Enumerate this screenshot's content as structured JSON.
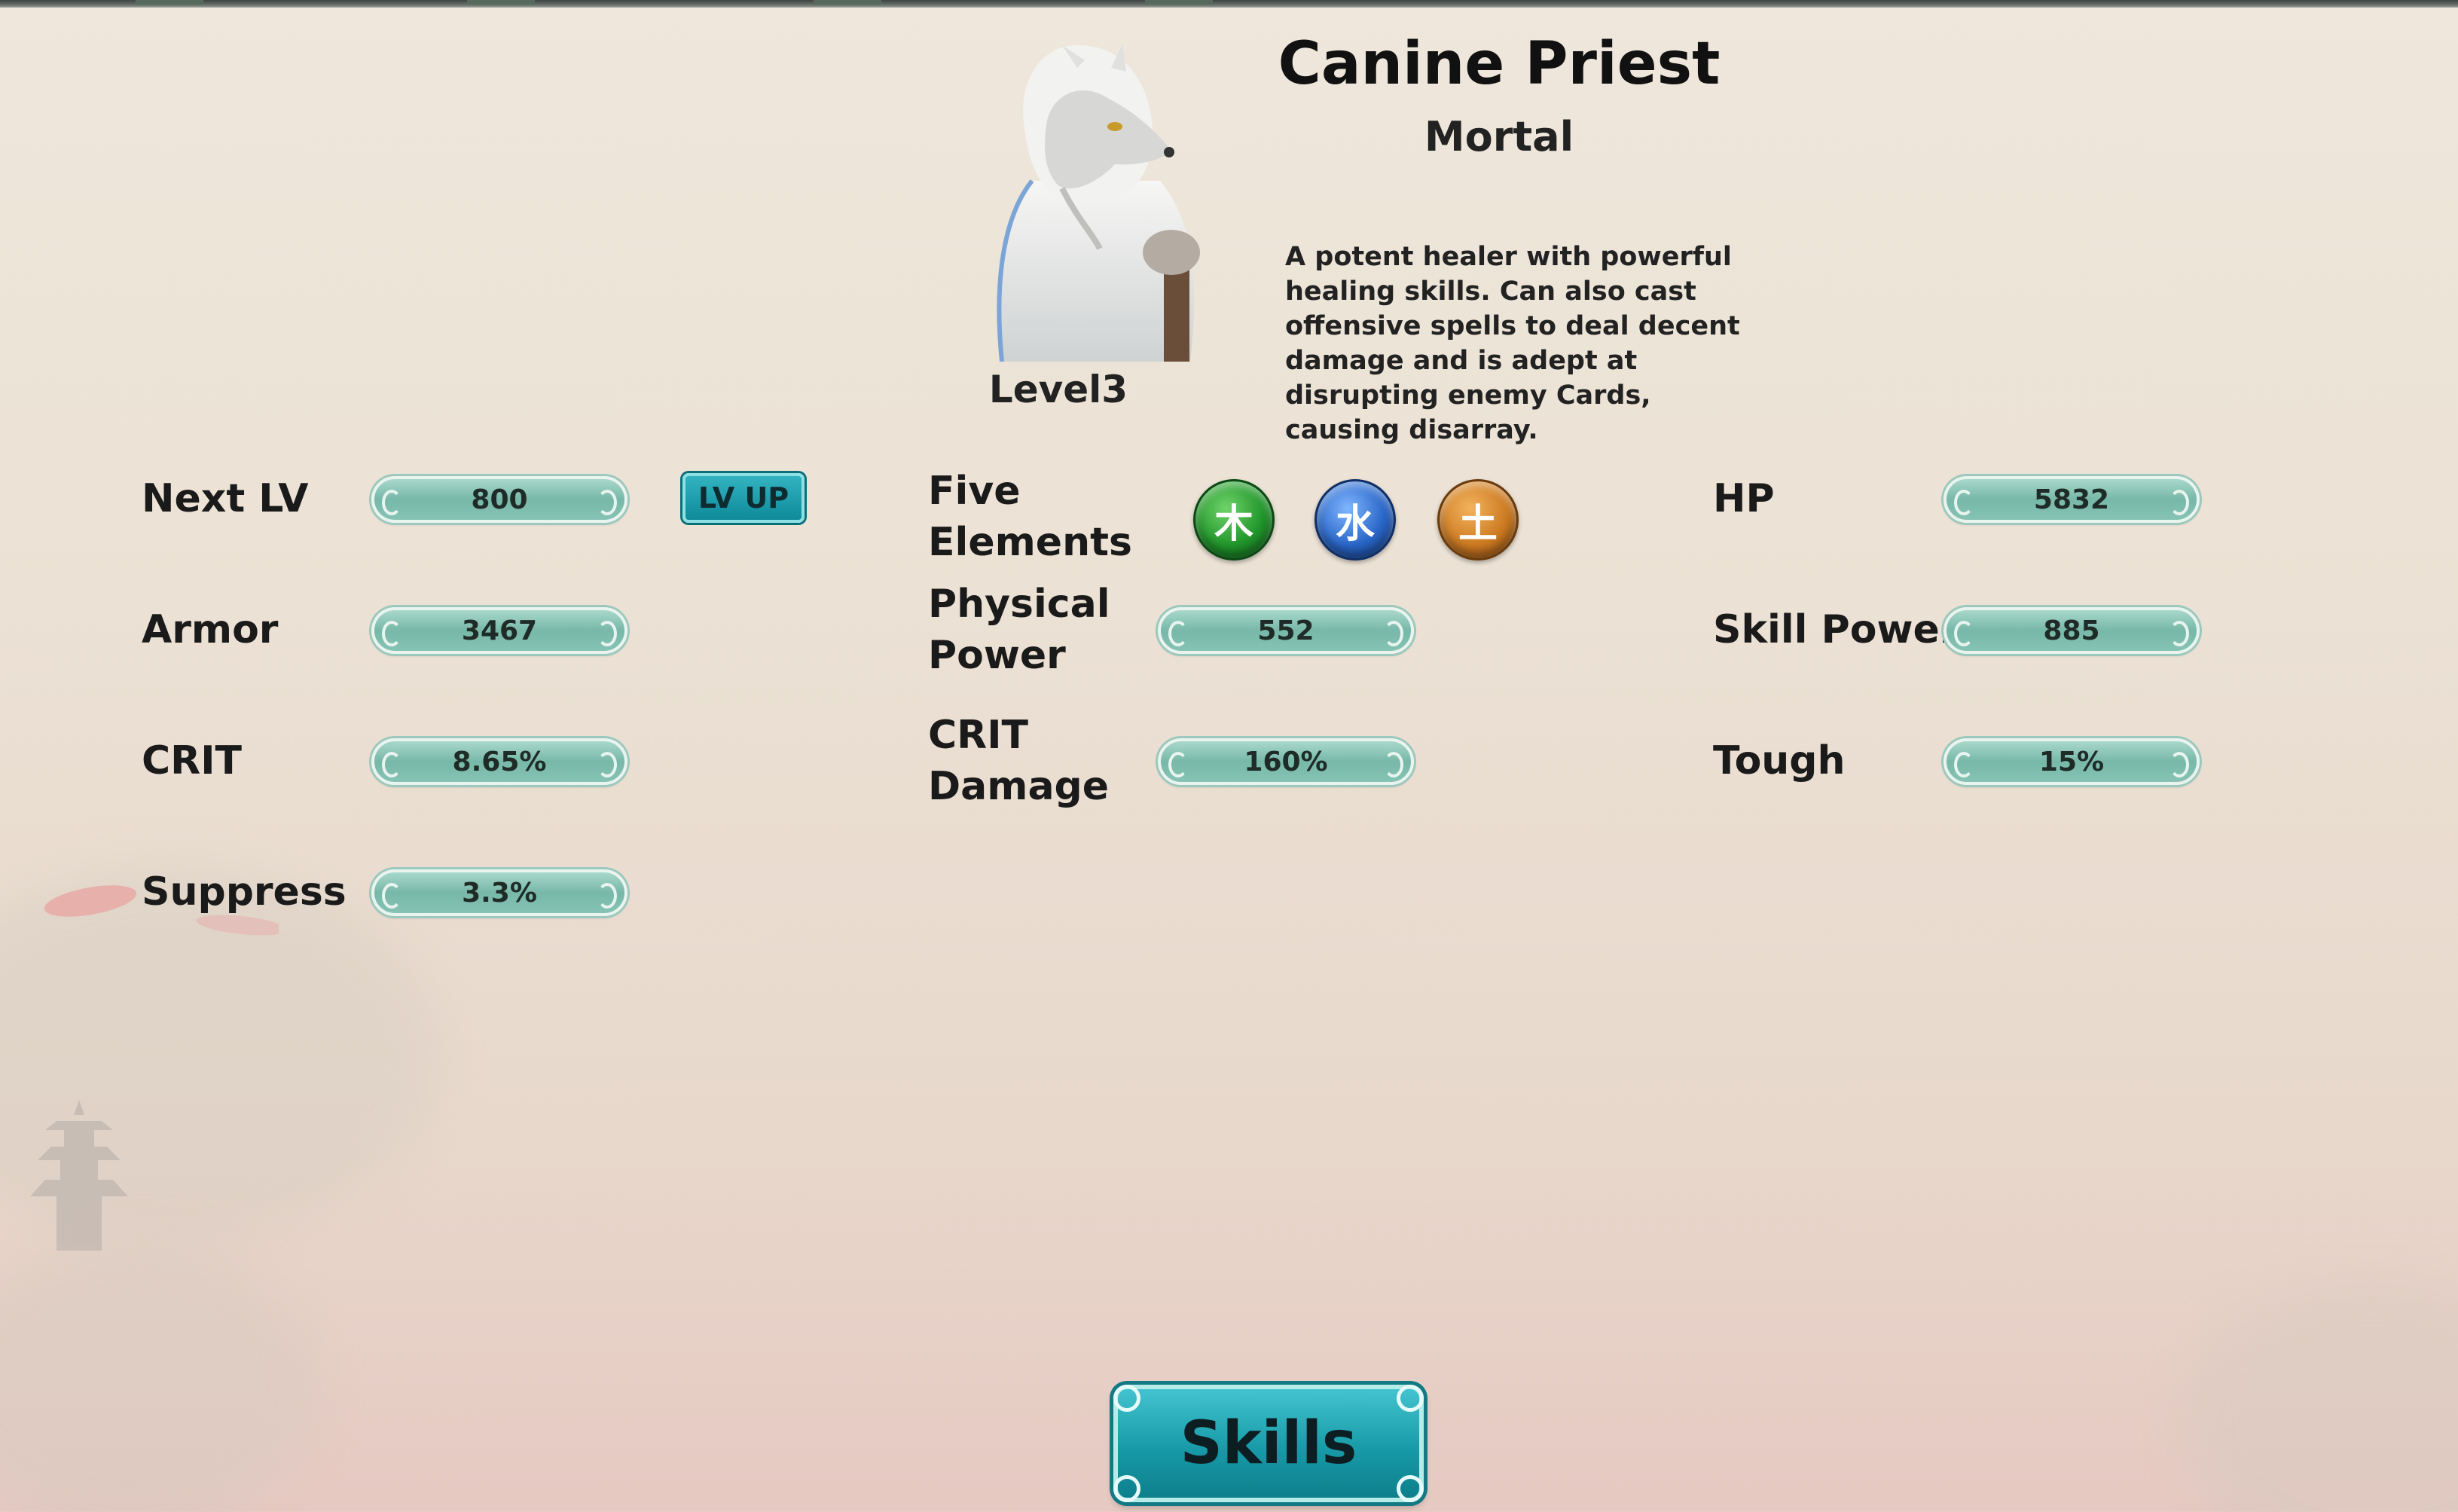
{
  "character": {
    "name": "Canine Priest",
    "rank": "Mortal",
    "level": "Level3",
    "description": "A potent healer with powerful healing skills. Can also cast offensive spells to deal decent damage and is adept at disrupting enemy Cards, causing disarray."
  },
  "stats": {
    "next_lv": {
      "label": "Next LV",
      "value": "800"
    },
    "armor": {
      "label": "Armor",
      "value": "3467"
    },
    "crit": {
      "label": "CRIT",
      "value": "8.65%"
    },
    "suppress": {
      "label": "Suppress",
      "value": "3.3%"
    },
    "five_elements": {
      "label_line1": "Five",
      "label_line2": "Elements"
    },
    "physical_power": {
      "label_line1": "Physical",
      "label_line2": "Power",
      "value": "552"
    },
    "crit_damage": {
      "label_line1": "CRIT",
      "label_line2": "Damage",
      "value": "160%"
    },
    "hp": {
      "label": "HP",
      "value": "5832"
    },
    "skill_power": {
      "label": "Skill Power",
      "value": "885"
    },
    "tough": {
      "label": "Tough",
      "value": "15%"
    }
  },
  "elements": [
    {
      "glyph": "木",
      "icon": "wood-element-icon",
      "color": "#21962b"
    },
    {
      "glyph": "水",
      "icon": "water-element-icon",
      "color": "#2a66c8"
    },
    {
      "glyph": "土",
      "icon": "earth-element-icon",
      "color": "#cc7a22"
    }
  ],
  "buttons": {
    "lv_up": "LV UP",
    "skills": "Skills"
  },
  "colors": {
    "pill": "#86c3b4",
    "button_teal": "#189aa8",
    "background": "#ebe1d4"
  }
}
